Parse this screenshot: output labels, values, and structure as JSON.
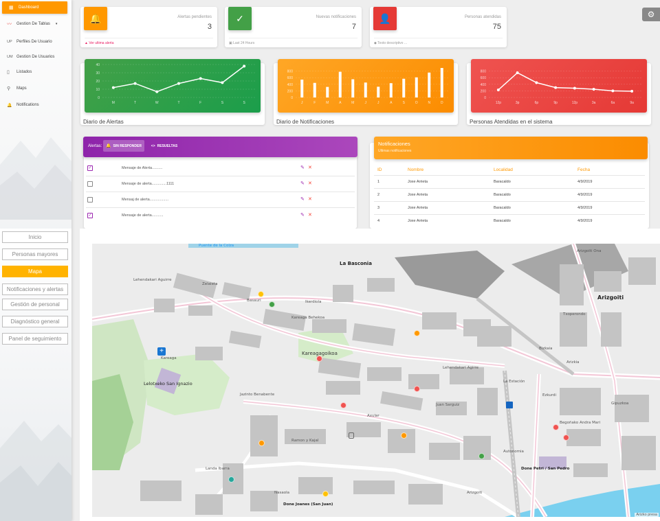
{
  "sidebar": {
    "items": [
      {
        "label": "Dashboard",
        "icon": "dashboard-icon",
        "glyph": "▦"
      },
      {
        "label": "Gestion De Tablas",
        "icon": "waves-icon",
        "glyph": "〰"
      },
      {
        "label": "Perfiles De Usuario",
        "icon": "up-abbr",
        "glyph": "UP"
      },
      {
        "label": "Gestion De Usuarios",
        "icon": "um-abbr",
        "glyph": "UM"
      },
      {
        "label": "Listados",
        "icon": "clipboard-icon",
        "glyph": "▯"
      },
      {
        "label": "Maps",
        "icon": "map-pin-icon",
        "glyph": "⚲"
      },
      {
        "label": "Notifications",
        "icon": "bell-icon",
        "glyph": "🔔"
      }
    ],
    "dropdown_glyph": "▾"
  },
  "menu2": [
    "Inicio",
    "Personas mayores",
    "Mapa",
    "Notificaciones y alertas",
    "Gestión de personal",
    "Diagnóstico general",
    "Panel de seguimiento"
  ],
  "stats": [
    {
      "category": "Alertas pendientes",
      "value": "3",
      "footer": "Ver ultima alerta",
      "color": "#ff9800",
      "icon": "bell-icon",
      "glyph": "🔔",
      "footer_icon": "warning-icon",
      "footer_glyph": "▲",
      "footer_color": "#e91e63"
    },
    {
      "category": "Nuevas notificaciones",
      "value": "7",
      "footer": "Last 24 Hours",
      "color": "#43a047",
      "icon": "check-icon",
      "glyph": "✓",
      "footer_icon": "calendar-icon",
      "footer_glyph": "▣",
      "footer_color": "#999"
    },
    {
      "category": "Personas atendidas",
      "value": "75",
      "footer": "Texto descriptivo ...",
      "color": "#e53935",
      "icon": "person-check-icon",
      "glyph": "👤",
      "footer_icon": "tag-icon",
      "footer_glyph": "◆",
      "footer_color": "#999"
    }
  ],
  "settings_icon": "⚙",
  "charts": [
    {
      "title": "Diario de Alertas",
      "gradient": [
        "#43a047",
        "#1b9e4b"
      ],
      "chart_data": {
        "type": "line",
        "categories": [
          "M",
          "T",
          "W",
          "T",
          "F",
          "S",
          "S"
        ],
        "values": [
          12,
          17,
          7,
          17,
          23,
          18,
          38
        ],
        "ylim": [
          0,
          40
        ],
        "yticks": [
          0,
          10,
          20,
          30,
          40
        ]
      }
    },
    {
      "title": "Diario de Notificaciones",
      "gradient": [
        "#ffa726",
        "#fb8c00"
      ],
      "chart_data": {
        "type": "bar",
        "categories": [
          "J",
          "F",
          "M",
          "A",
          "M",
          "J",
          "J",
          "A",
          "S",
          "O",
          "N",
          "D"
        ],
        "values": [
          542,
          443,
          320,
          780,
          553,
          453,
          326,
          434,
          568,
          610,
          756,
          895
        ],
        "ylim": [
          0,
          1000
        ],
        "yticks": [
          0,
          200,
          400,
          600,
          800
        ]
      }
    },
    {
      "title": "Personas Atendidas en el sistema",
      "gradient": [
        "#ef5350",
        "#e53935"
      ],
      "chart_data": {
        "type": "line",
        "categories": [
          "12p",
          "3p",
          "6p",
          "9p",
          "12p",
          "3a",
          "6a",
          "9a"
        ],
        "values": [
          230,
          750,
          450,
          300,
          280,
          250,
          200,
          190
        ],
        "ylim": [
          0,
          1000
        ],
        "yticks": [
          0,
          200,
          400,
          600,
          800
        ]
      }
    }
  ],
  "alerts_card": {
    "label": "Alertas:",
    "tabs": [
      {
        "label": "SIN RESPONDER",
        "icon": "bell-icon",
        "glyph": "🔔"
      },
      {
        "label": "RESUELTAS",
        "icon": "code-icon",
        "glyph": "<>"
      }
    ],
    "rows": [
      {
        "text": "Mensaje de Alerta..........",
        "checked": true
      },
      {
        "text": "Mensaje de alerta..............1111",
        "checked": false
      },
      {
        "text": "Mensaj de alerta..................",
        "checked": false
      },
      {
        "text": "Mensaje de alerta...........",
        "checked": true
      }
    ],
    "edit_glyph": "✎",
    "delete_glyph": "✕",
    "check_glyph": "✓"
  },
  "notif_card": {
    "title": "Notificaciones",
    "subtitle": "Ultimas notificaciones",
    "headers": [
      "ID",
      "Nombre",
      "Localidad",
      "Fecha"
    ],
    "rows": [
      [
        "1",
        "Joxe Arrieta",
        "Baracaldo",
        "4/9/2019"
      ],
      [
        "2",
        "Joxe Arrieta",
        "Baracaldo",
        "4/9/2019"
      ],
      [
        "3",
        "Joxe Arrieta",
        "Baracaldo",
        "4/9/2019"
      ],
      [
        "4",
        "Joxe Arrieta",
        "Baracaldo",
        "4/9/2019"
      ]
    ]
  },
  "map": {
    "labels": [
      "Puente de la Colza",
      "La Basconia",
      "Arizgoiti",
      "Arizgoiti Ona",
      "Kareaga",
      "Kareagagoikoa",
      "Lelotxeko San Ignazio",
      "La Estación",
      "Begoñako Andra Mari",
      "Done Petri / San Pedro",
      "Done Joanes (San Juan)",
      "Jazinto Benabente",
      "Ramon y Kajal",
      "Juan Sarguiz",
      "Axular",
      "Lehendakari Agirre",
      "Lehendakari Aguirre",
      "Zelaieta",
      "Txoperondo",
      "Ezkurdi",
      "Ikerdiola",
      "Kareaga Behekoa",
      "Basauri",
      "Landa Ibarra",
      "Nasaola",
      "Arizgoiti",
      "Autonomia",
      "Gipuzkoa",
      "Bizkaia",
      "Arizkia"
    ],
    "markers": [
      {
        "color": "#ffc107"
      },
      {
        "color": "#43a047"
      },
      {
        "color": "#ff9800"
      },
      {
        "color": "#ef5350"
      },
      {
        "color": "#ef5350"
      },
      {
        "color": "#ef5350"
      },
      {
        "color": "#ff9800"
      },
      {
        "color": "#ff9800"
      },
      {
        "color": "#43a047"
      },
      {
        "color": "#ef5350"
      },
      {
        "color": "#ef5350"
      },
      {
        "color": "#26a69a"
      },
      {
        "color": "#ffc107"
      }
    ],
    "attribution": "Arizko presa"
  }
}
